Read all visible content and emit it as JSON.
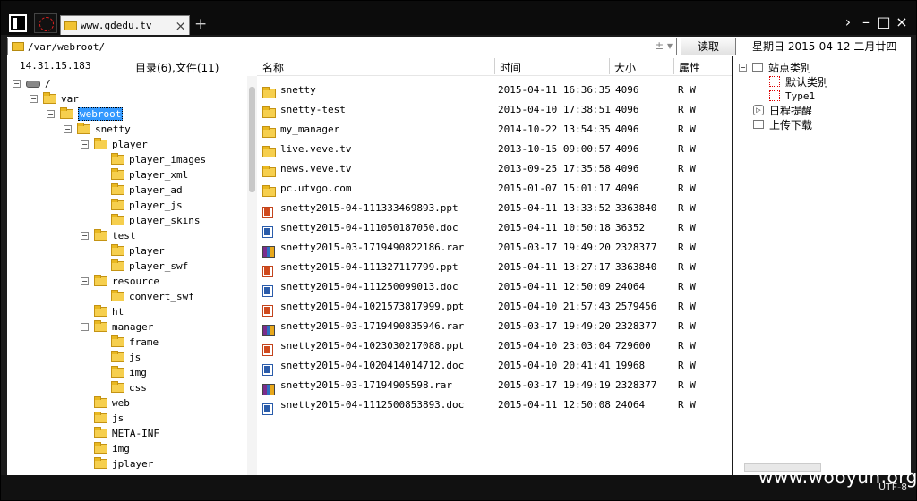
{
  "tab": {
    "title": "www.gdedu.tv",
    "close": "×",
    "add": "+"
  },
  "window_controls": {
    "arrow": "›",
    "minimize": "–",
    "maximize": "□",
    "close": "×"
  },
  "address": {
    "path": "/var/webroot/",
    "arrows": "± ▾",
    "read_button": "读取"
  },
  "date": "星期日 2015-04-12 二月廿四",
  "left": {
    "ip": "14.31.15.183",
    "dir_count": "目录(6),文件(11)"
  },
  "tree": [
    {
      "name": "/",
      "toggle": "-",
      "icon": "drive"
    },
    {
      "name": "var",
      "toggle": "-",
      "icon": "folder"
    },
    {
      "name": "webroot",
      "toggle": "-",
      "icon": "folder",
      "selected": true
    },
    {
      "name": "snetty",
      "toggle": "-",
      "icon": "folder"
    },
    {
      "name": "player",
      "toggle": "-",
      "icon": "folder"
    },
    {
      "name": "player_images",
      "toggle": "",
      "icon": "folder"
    },
    {
      "name": "player_xml",
      "toggle": "",
      "icon": "folder"
    },
    {
      "name": "player_ad",
      "toggle": "",
      "icon": "folder"
    },
    {
      "name": "player_js",
      "toggle": "",
      "icon": "folder"
    },
    {
      "name": "player_skins",
      "toggle": "",
      "icon": "folder"
    },
    {
      "name": "test",
      "toggle": "-",
      "icon": "folder"
    },
    {
      "name": "player",
      "toggle": "",
      "icon": "folder"
    },
    {
      "name": "player_swf",
      "toggle": "",
      "icon": "folder"
    },
    {
      "name": "resource",
      "toggle": "-",
      "icon": "folder"
    },
    {
      "name": "convert_swf",
      "toggle": "",
      "icon": "folder"
    },
    {
      "name": "ht",
      "toggle": "",
      "icon": "folder"
    },
    {
      "name": "manager",
      "toggle": "-",
      "icon": "folder"
    },
    {
      "name": "frame",
      "toggle": "",
      "icon": "folder"
    },
    {
      "name": "js",
      "toggle": "",
      "icon": "folder"
    },
    {
      "name": "img",
      "toggle": "",
      "icon": "folder"
    },
    {
      "name": "css",
      "toggle": "",
      "icon": "folder"
    },
    {
      "name": "web",
      "toggle": "",
      "icon": "folder"
    },
    {
      "name": "js",
      "toggle": "",
      "icon": "folder"
    },
    {
      "name": "META-INF",
      "toggle": "",
      "icon": "folder"
    },
    {
      "name": "img",
      "toggle": "",
      "icon": "folder"
    },
    {
      "name": "jplayer",
      "toggle": "",
      "icon": "folder"
    }
  ],
  "columns": {
    "name": "名称",
    "time": "时间",
    "size": "大小",
    "attr": "属性"
  },
  "files": [
    {
      "name": "snetty",
      "time": "2015-04-11 16:36:35",
      "size": "4096",
      "attr": "R W",
      "type": "folder"
    },
    {
      "name": "snetty-test",
      "time": "2015-04-10 17:38:51",
      "size": "4096",
      "attr": "R W",
      "type": "folder"
    },
    {
      "name": "my_manager",
      "time": "2014-10-22 13:54:35",
      "size": "4096",
      "attr": "R W",
      "type": "folder"
    },
    {
      "name": "live.veve.tv",
      "time": "2013-10-15 09:00:57",
      "size": "4096",
      "attr": "R W",
      "type": "folder"
    },
    {
      "name": "news.veve.tv",
      "time": "2013-09-25 17:35:58",
      "size": "4096",
      "attr": "R W",
      "type": "folder"
    },
    {
      "name": "pc.utvgo.com",
      "time": "2015-01-07 15:01:17",
      "size": "4096",
      "attr": "R W",
      "type": "folder"
    },
    {
      "name": "snetty2015-04-111333469893.ppt",
      "time": "2015-04-11 13:33:52",
      "size": "3363840",
      "attr": "R W",
      "type": "ppt"
    },
    {
      "name": "snetty2015-04-111050187050.doc",
      "time": "2015-04-11 10:50:18",
      "size": "36352",
      "attr": "R W",
      "type": "doc"
    },
    {
      "name": "snetty2015-03-1719490822186.rar",
      "time": "2015-03-17 19:49:20",
      "size": "2328377",
      "attr": "R W",
      "type": "rar"
    },
    {
      "name": "snetty2015-04-111327117799.ppt",
      "time": "2015-04-11 13:27:17",
      "size": "3363840",
      "attr": "R W",
      "type": "ppt"
    },
    {
      "name": "snetty2015-04-111250099013.doc",
      "time": "2015-04-11 12:50:09",
      "size": "24064",
      "attr": "R W",
      "type": "doc"
    },
    {
      "name": "snetty2015-04-1021573817999.ppt",
      "time": "2015-04-10 21:57:43",
      "size": "2579456",
      "attr": "R W",
      "type": "ppt"
    },
    {
      "name": "snetty2015-03-1719490835946.rar",
      "time": "2015-03-17 19:49:20",
      "size": "2328377",
      "attr": "R W",
      "type": "rar"
    },
    {
      "name": "snetty2015-04-1023030217088.ppt",
      "time": "2015-04-10 23:03:04",
      "size": "729600",
      "attr": "R W",
      "type": "ppt"
    },
    {
      "name": "snetty2015-04-1020414014712.doc",
      "time": "2015-04-10 20:41:41",
      "size": "19968",
      "attr": "R W",
      "type": "doc"
    },
    {
      "name": "snetty2015-03-17194905598.rar",
      "time": "2015-03-17 19:49:19",
      "size": "2328377",
      "attr": "R W",
      "type": "rar"
    },
    {
      "name": "snetty2015-04-1112500853893.doc",
      "time": "2015-04-11 12:50:08",
      "size": "24064",
      "attr": "R W",
      "type": "doc"
    }
  ],
  "right": {
    "site_category": "站点类别",
    "default_category": "默认类别",
    "type1": "Type1",
    "schedule": "日程提醒",
    "upload": "上传下载"
  },
  "footer": {
    "watermark": "www.wooyun.org",
    "encoding": "UTF-8"
  }
}
